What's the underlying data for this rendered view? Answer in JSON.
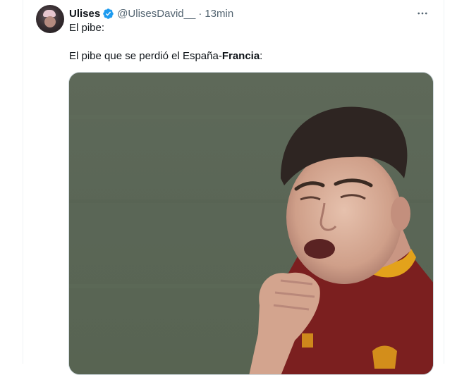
{
  "tweet": {
    "display_name": "Ulises",
    "handle": "@UlisesDavid__",
    "separator": "·",
    "time": "13min",
    "line1": "El pibe:",
    "line2_prefix": "El pibe que se perdió el España-",
    "line2_bold": "Francia",
    "line2_suffix": ":"
  },
  "icons": {
    "verified": "verified-badge-icon",
    "more": "more-icon",
    "verified_color": "#1d9bf0"
  }
}
